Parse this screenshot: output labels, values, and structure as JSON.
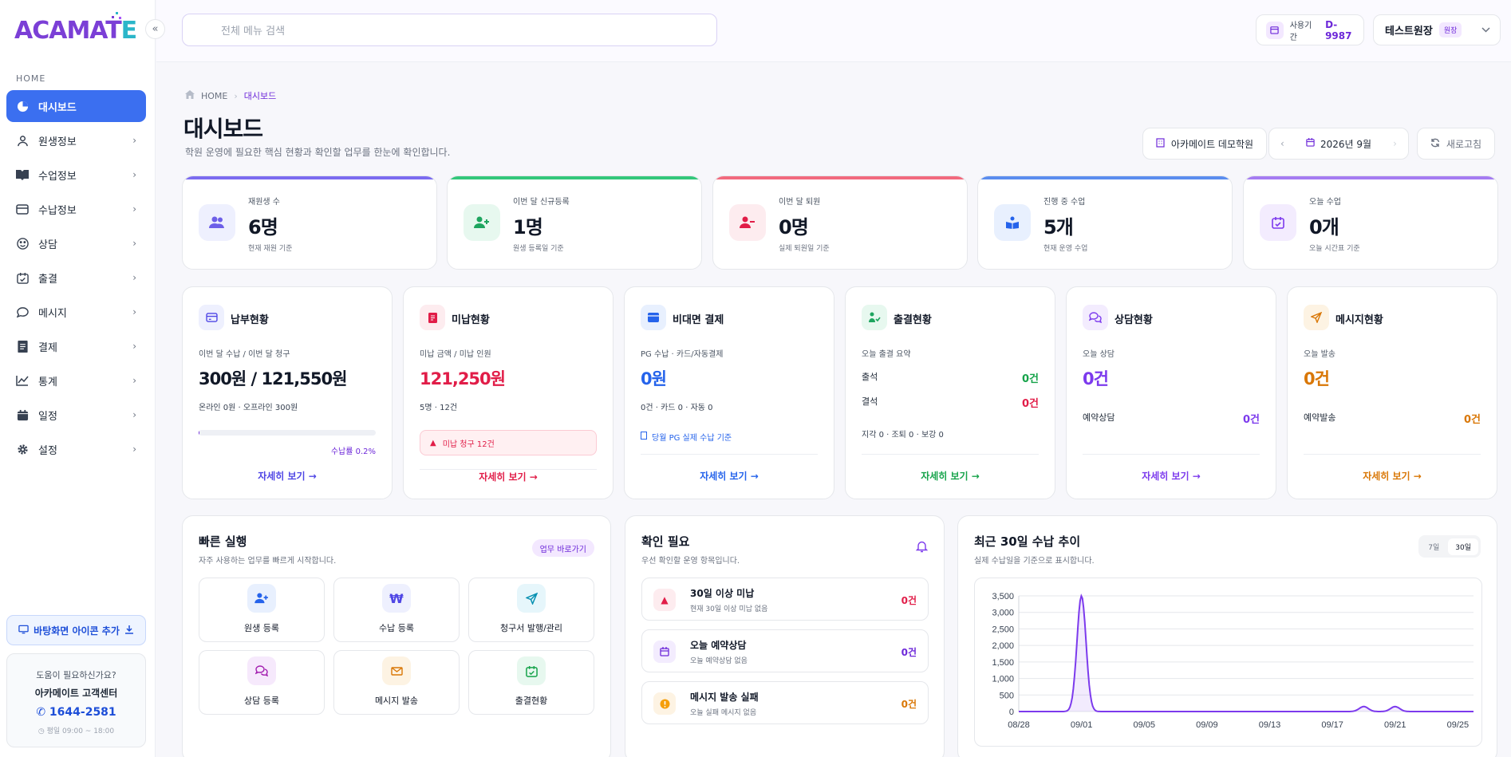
{
  "brand": {
    "logo_main": "ACAMAT",
    "logo_e": "E"
  },
  "sidebar": {
    "section": "HOME",
    "items": [
      {
        "label": "대시보드",
        "icon": "pie-chart-icon"
      },
      {
        "label": "원생정보",
        "icon": "user-icon"
      },
      {
        "label": "수업정보",
        "icon": "book-icon"
      },
      {
        "label": "수납정보",
        "icon": "credit-card-icon"
      },
      {
        "label": "상담",
        "icon": "smile-icon"
      },
      {
        "label": "출결",
        "icon": "calendar-check-icon"
      },
      {
        "label": "메시지",
        "icon": "chat-icon"
      },
      {
        "label": "결제",
        "icon": "receipt-icon"
      },
      {
        "label": "통계",
        "icon": "line-chart-icon"
      },
      {
        "label": "일정",
        "icon": "calendar-icon"
      },
      {
        "label": "설정",
        "icon": "gear-icon"
      }
    ],
    "desktop_button": "바탕화면 아이콘 추가",
    "help": {
      "question": "도움이 필요하신가요?",
      "name": "아카메이트 고객센터",
      "phone": "1644-2581",
      "hours": "평일 09:00 ~ 18:00"
    }
  },
  "topbar": {
    "search_placeholder": "전체 메뉴 검색",
    "usage_label": "사용기간",
    "usage_value": "D-9987",
    "user_name": "테스트원장",
    "user_role": "원장"
  },
  "page": {
    "breadcrumb_home": "HOME",
    "breadcrumb_current": "대시보드",
    "title": "대시보드",
    "subtitle": "학원 운영에 필요한 핵심 현황과 확인할 업무를 한눈에 확인합니다.",
    "academy_button": "아카메이트 데모학원",
    "month": "2026년 9월",
    "refresh": "새로고침"
  },
  "kpis": [
    {
      "label": "재원생 수",
      "value": "6명",
      "sub": "현재 재원 기준",
      "color": "#7c6cf0"
    },
    {
      "label": "이번 달 신규등록",
      "value": "1명",
      "sub": "원생 등록일 기준",
      "color": "#34c77b"
    },
    {
      "label": "이번 달 퇴원",
      "value": "0명",
      "sub": "실제 퇴원일 기준",
      "color": "#f26a7e"
    },
    {
      "label": "진행 중 수업",
      "value": "5개",
      "sub": "현재 운영 수업",
      "color": "#5b8def"
    },
    {
      "label": "오늘 수업",
      "value": "0개",
      "sub": "오늘 시간표 기준",
      "color": "#a57cf2"
    }
  ],
  "cards": {
    "payment": {
      "title": "납부현황",
      "label": "이번 달 수납 / 이번 달 청구",
      "value": "300원 / 121,550원",
      "sub": "온라인 0원 · 오프라인 300원",
      "rate_label": "수납률 0.2%",
      "rate": 0.2,
      "more": "자세히 보기 →"
    },
    "unpaid": {
      "title": "미납현황",
      "label": "미납 금액 / 미납 인원",
      "value": "121,250원",
      "sub": "5명 · 12건",
      "alert": "미납 청구 12건",
      "more": "자세히 보기 →"
    },
    "online": {
      "title": "비대면 결제",
      "label": "PG 수납 · 카드/자동결제",
      "value": "0원",
      "sub": "0건 · 카드 0 · 자동 0",
      "note": "당월 PG 실제 수납 기준",
      "more": "자세히 보기 →"
    },
    "attendance": {
      "title": "출결현황",
      "label": "오늘 출결 요약",
      "present_label": "출석",
      "present_value": "0건",
      "absent_label": "결석",
      "absent_value": "0건",
      "extra": "지각 0 · 조퇴 0 · 보강 0",
      "more": "자세히 보기 →"
    },
    "consult": {
      "title": "상담현황",
      "label": "오늘 상담",
      "value": "0건",
      "row_label": "예약상담",
      "row_value": "0건",
      "more": "자세히 보기 →"
    },
    "message": {
      "title": "메시지현황",
      "label": "오늘 발송",
      "value": "0건",
      "row_label": "예약발송",
      "row_value": "0건",
      "more": "자세히 보기 →"
    }
  },
  "quick": {
    "title": "빠른 실행",
    "subtitle": "자주 사용하는 업무를 빠르게 시작합니다.",
    "badge": "업무 바로가기",
    "tiles": [
      {
        "label": "원생 등록",
        "icon": "user-plus-icon"
      },
      {
        "label": "수납 등록",
        "icon": "won-icon"
      },
      {
        "label": "청구서 발행/관리",
        "icon": "send-icon"
      },
      {
        "label": "상담 등록",
        "icon": "chat-icon"
      },
      {
        "label": "메시지 발송",
        "icon": "mail-icon"
      },
      {
        "label": "출결현황",
        "icon": "calendar-check-icon"
      }
    ]
  },
  "checks": {
    "title": "확인 필요",
    "subtitle": "우선 확인할 운영 항목입니다.",
    "items": [
      {
        "title": "30일 이상 미납",
        "sub": "현재 30일 이상 미납 없음",
        "value": "0건",
        "color": "#e11d48"
      },
      {
        "title": "오늘 예약상담",
        "sub": "오늘 예약상담 없음",
        "value": "0건",
        "color": "#6d28d9"
      },
      {
        "title": "메시지 발송 실패",
        "sub": "오늘 실패 메시지 없음",
        "value": "0건",
        "color": "#d97706"
      }
    ]
  },
  "trend": {
    "title": "최근 30일 수납 추이",
    "subtitle": "실제 수납일을 기준으로 표시합니다.",
    "tab_7": "7일",
    "tab_30": "30일"
  },
  "chart_data": {
    "type": "line",
    "x": [
      "08/28",
      "08/29",
      "08/30",
      "08/31",
      "09/01",
      "09/02",
      "09/03",
      "09/04",
      "09/05",
      "09/06",
      "09/07",
      "09/08",
      "09/09",
      "09/10",
      "09/11",
      "09/12",
      "09/13",
      "09/14",
      "09/15",
      "09/16",
      "09/17",
      "09/18",
      "09/19",
      "09/20",
      "09/21",
      "09/22",
      "09/23",
      "09/24",
      "09/25",
      "09/26"
    ],
    "series": [
      {
        "values": [
          0,
          0,
          0,
          0,
          3500,
          0,
          0,
          0,
          0,
          0,
          0,
          0,
          0,
          0,
          0,
          0,
          0,
          0,
          0,
          0,
          0,
          0,
          150,
          0,
          150,
          0,
          0,
          0,
          0,
          0
        ]
      }
    ],
    "x_ticks": [
      "08/28",
      "09/01",
      "09/05",
      "09/09",
      "09/13",
      "09/17",
      "09/21",
      "09/25"
    ],
    "y_ticks": [
      "0",
      "500",
      "1,000",
      "1,500",
      "2,000",
      "2,500",
      "3,000",
      "3,500"
    ],
    "ylim": [
      0,
      3500
    ],
    "color": "#7c3aed"
  }
}
